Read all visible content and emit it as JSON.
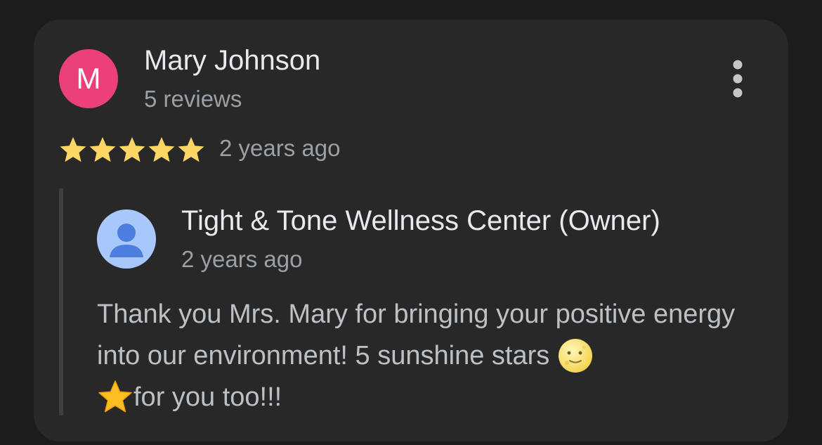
{
  "review": {
    "avatar_letter": "M",
    "avatar_color": "#ec407a",
    "reviewer_name": "Mary Johnson",
    "reviewer_count": "5 reviews",
    "rating": 5,
    "rating_max": 5,
    "star_color": "#fdd663",
    "time": "2 years ago",
    "more_icon": "more-vert-icon"
  },
  "owner_reply": {
    "avatar_icon": "person-icon",
    "avatar_color": "#a8c7fa",
    "name": "Tight & Tone Wellness Center (Owner)",
    "time": "2 years ago",
    "text_part1": "Thank you Mrs. Mary for bringing your positive energy into our environment! 5 sunshine stars ",
    "emoji1": "full-moon-face-emoji",
    "emoji2": "star-emoji",
    "text_part2": "for you too!!!"
  }
}
